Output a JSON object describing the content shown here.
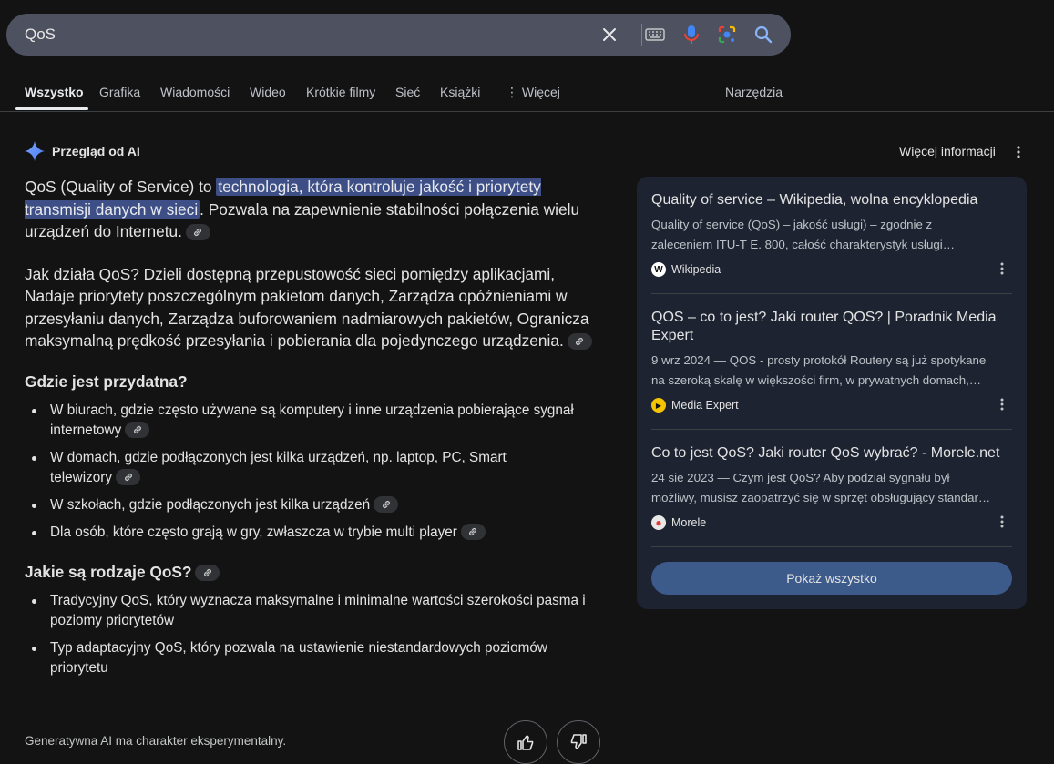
{
  "search": {
    "query": "QoS",
    "icons": [
      "close-icon",
      "keyboard-icon",
      "microphone-icon",
      "lens-icon",
      "search-icon"
    ]
  },
  "tabs": [
    {
      "label": "Wszystko",
      "active": true
    },
    {
      "label": "Grafika"
    },
    {
      "label": "Wiadomości"
    },
    {
      "label": "Wideo"
    },
    {
      "label": "Krótkie filmy"
    },
    {
      "label": "Sieć"
    },
    {
      "label": "Książki"
    },
    {
      "label": "⋮ Więcej"
    }
  ],
  "tools_label": "Narzędzia",
  "ai_overview": {
    "title": "Przegląd od AI",
    "more_info": "Więcej informacji",
    "intro_before": "QoS (Quality of Service) to ",
    "intro_highlight": "technologia, która kontroluje jakość i priorytety transmisji danych w sieci",
    "intro_after": ". Pozwala na zapewnienie stabilności połączenia wielu urządzeń do Internetu.",
    "how": "Jak działa QoS? Dzieli dostępną przepustowość sieci pomiędzy aplikacjami, Nadaje priorytety poszczególnym pakietom danych, Zarządza opóźnieniami w przesyłaniu danych, Zarządza buforowaniem nadmiarowych pakietów, Ogranicza maksymalną prędkość przesyłania i pobierania dla pojedynczego urządzenia.",
    "where_heading": "Gdzie jest przydatna?",
    "where_items": [
      "W biurach, gdzie często używane są komputery i inne urządzenia pobierające sygnał internetowy",
      "W domach, gdzie podłączonych jest kilka urządzeń, np. laptop, PC, Smart telewizory",
      "W szkołach, gdzie podłączonych jest kilka urządzeń",
      "Dla osób, które często grają w gry, zwłaszcza w trybie multi player"
    ],
    "types_heading": "Jakie są rodzaje QoS?",
    "types_items": [
      "Tradycyjny QoS, który wyznacza maksymalne i minimalne wartości szerokości pasma i poziomy priorytetów",
      "Typ adaptacyjny QoS, który pozwala na ustawienie niestandardowych poziomów priorytetu"
    ],
    "disclaimer": "Generatywna AI ma charakter eksperymentalny."
  },
  "sources": [
    {
      "title": "Quality of service – Wikipedia, wolna encyklopedia",
      "desc1": "Quality of service (QoS) – jakość usługi) – zgodnie z",
      "desc2": "zaleceniem ITU-T E. 800, całość charakterystyk usługi…",
      "site": "Wikipedia",
      "favicon": "W"
    },
    {
      "title": "QOS – co to jest? Jaki router QOS? | Poradnik Media Expert",
      "desc1": "9 wrz 2024 — QOS - prosty protokół Routery są już spotykane",
      "desc2": "na szeroką skalę w większości firm, w prywatnych domach,…",
      "site": "Media Expert",
      "favicon": "▶"
    },
    {
      "title": "Co to jest QoS? Jaki router QoS wybrać? - Morele.net",
      "desc1": "24 sie 2023 — Czym jest QoS? Aby podział sygnału był",
      "desc2": "możliwy, musisz zaopatrzyć się w sprzęt obsługujący standar…",
      "site": "Morele",
      "favicon": "●"
    }
  ],
  "show_all": "Pokaż wszystko",
  "colors": {
    "background": "#131314",
    "search_bar": "#4d5160",
    "highlight": "#3d4f86",
    "sources_panel": "#1d2331",
    "show_all_button": "#3c5a8a"
  }
}
